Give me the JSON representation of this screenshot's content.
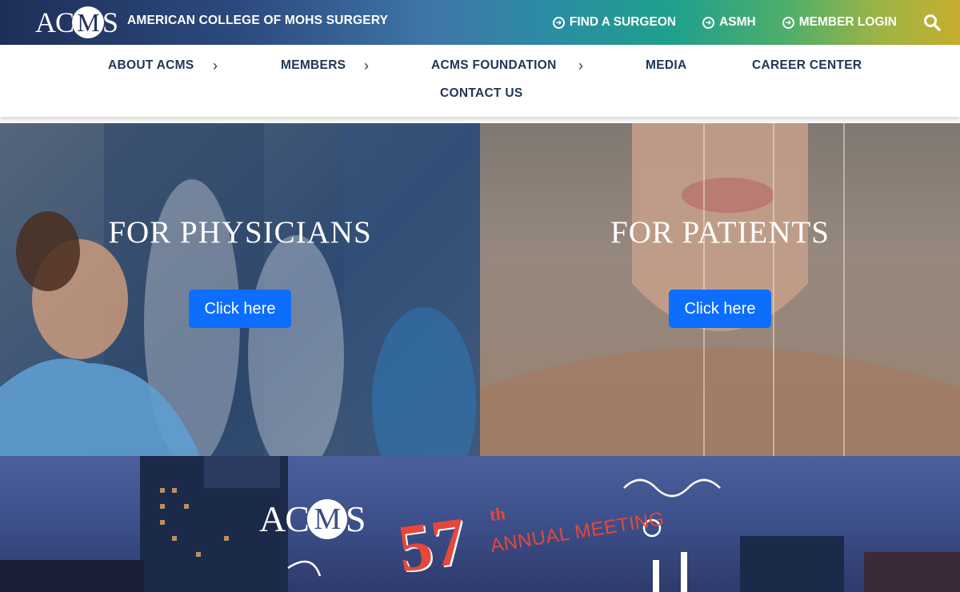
{
  "header": {
    "logo_text": "ACMS",
    "org_name": "AMERICAN COLLEGE OF MOHS SURGERY",
    "links": [
      {
        "label": "FIND A SURGEON",
        "icon": "arrow-circle-icon"
      },
      {
        "label": "ASMH",
        "icon": "arrow-circle-icon"
      },
      {
        "label": "MEMBER LOGIN",
        "icon": "arrow-circle-icon"
      }
    ],
    "search_icon": "search-icon"
  },
  "nav": {
    "items": [
      {
        "label": "ABOUT ACMS",
        "has_submenu": true
      },
      {
        "label": "MEMBERS",
        "has_submenu": true
      },
      {
        "label": "ACMS FOUNDATION",
        "has_submenu": true
      },
      {
        "label": "MEDIA",
        "has_submenu": false
      },
      {
        "label": "CAREER CENTER",
        "has_submenu": false
      },
      {
        "label": "CONTACT US",
        "has_submenu": false
      }
    ]
  },
  "panels": [
    {
      "title": "FOR PHYSICIANS",
      "button_label": "Click here"
    },
    {
      "title": "FOR PATIENTS",
      "button_label": "Click here"
    }
  ],
  "banner": {
    "logo_text": "ACMS",
    "number": "57",
    "suffix": "th",
    "text": "ANNUAL MEETING"
  },
  "colors": {
    "primary_button": "#0d6efd",
    "nav_text": "#233556",
    "accent_red": "#e5473a"
  }
}
